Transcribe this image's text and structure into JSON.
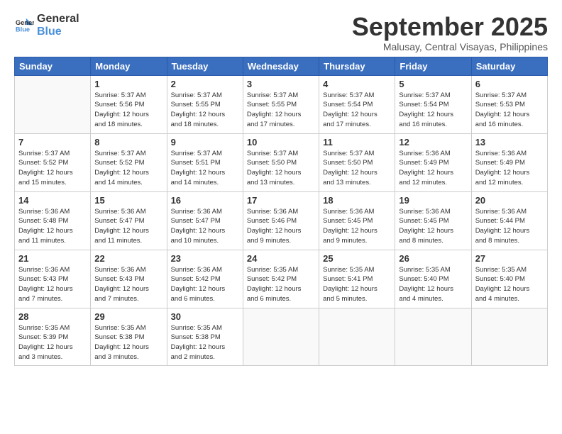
{
  "logo": {
    "text_general": "General",
    "text_blue": "Blue"
  },
  "header": {
    "month_year": "September 2025",
    "location": "Malusay, Central Visayas, Philippines"
  },
  "weekdays": [
    "Sunday",
    "Monday",
    "Tuesday",
    "Wednesday",
    "Thursday",
    "Friday",
    "Saturday"
  ],
  "weeks": [
    [
      {
        "day": "",
        "info": ""
      },
      {
        "day": "1",
        "info": "Sunrise: 5:37 AM\nSunset: 5:56 PM\nDaylight: 12 hours\nand 18 minutes."
      },
      {
        "day": "2",
        "info": "Sunrise: 5:37 AM\nSunset: 5:55 PM\nDaylight: 12 hours\nand 18 minutes."
      },
      {
        "day": "3",
        "info": "Sunrise: 5:37 AM\nSunset: 5:55 PM\nDaylight: 12 hours\nand 17 minutes."
      },
      {
        "day": "4",
        "info": "Sunrise: 5:37 AM\nSunset: 5:54 PM\nDaylight: 12 hours\nand 17 minutes."
      },
      {
        "day": "5",
        "info": "Sunrise: 5:37 AM\nSunset: 5:54 PM\nDaylight: 12 hours\nand 16 minutes."
      },
      {
        "day": "6",
        "info": "Sunrise: 5:37 AM\nSunset: 5:53 PM\nDaylight: 12 hours\nand 16 minutes."
      }
    ],
    [
      {
        "day": "7",
        "info": "Sunrise: 5:37 AM\nSunset: 5:52 PM\nDaylight: 12 hours\nand 15 minutes."
      },
      {
        "day": "8",
        "info": "Sunrise: 5:37 AM\nSunset: 5:52 PM\nDaylight: 12 hours\nand 14 minutes."
      },
      {
        "day": "9",
        "info": "Sunrise: 5:37 AM\nSunset: 5:51 PM\nDaylight: 12 hours\nand 14 minutes."
      },
      {
        "day": "10",
        "info": "Sunrise: 5:37 AM\nSunset: 5:50 PM\nDaylight: 12 hours\nand 13 minutes."
      },
      {
        "day": "11",
        "info": "Sunrise: 5:37 AM\nSunset: 5:50 PM\nDaylight: 12 hours\nand 13 minutes."
      },
      {
        "day": "12",
        "info": "Sunrise: 5:36 AM\nSunset: 5:49 PM\nDaylight: 12 hours\nand 12 minutes."
      },
      {
        "day": "13",
        "info": "Sunrise: 5:36 AM\nSunset: 5:49 PM\nDaylight: 12 hours\nand 12 minutes."
      }
    ],
    [
      {
        "day": "14",
        "info": "Sunrise: 5:36 AM\nSunset: 5:48 PM\nDaylight: 12 hours\nand 11 minutes."
      },
      {
        "day": "15",
        "info": "Sunrise: 5:36 AM\nSunset: 5:47 PM\nDaylight: 12 hours\nand 11 minutes."
      },
      {
        "day": "16",
        "info": "Sunrise: 5:36 AM\nSunset: 5:47 PM\nDaylight: 12 hours\nand 10 minutes."
      },
      {
        "day": "17",
        "info": "Sunrise: 5:36 AM\nSunset: 5:46 PM\nDaylight: 12 hours\nand 9 minutes."
      },
      {
        "day": "18",
        "info": "Sunrise: 5:36 AM\nSunset: 5:45 PM\nDaylight: 12 hours\nand 9 minutes."
      },
      {
        "day": "19",
        "info": "Sunrise: 5:36 AM\nSunset: 5:45 PM\nDaylight: 12 hours\nand 8 minutes."
      },
      {
        "day": "20",
        "info": "Sunrise: 5:36 AM\nSunset: 5:44 PM\nDaylight: 12 hours\nand 8 minutes."
      }
    ],
    [
      {
        "day": "21",
        "info": "Sunrise: 5:36 AM\nSunset: 5:43 PM\nDaylight: 12 hours\nand 7 minutes."
      },
      {
        "day": "22",
        "info": "Sunrise: 5:36 AM\nSunset: 5:43 PM\nDaylight: 12 hours\nand 7 minutes."
      },
      {
        "day": "23",
        "info": "Sunrise: 5:36 AM\nSunset: 5:42 PM\nDaylight: 12 hours\nand 6 minutes."
      },
      {
        "day": "24",
        "info": "Sunrise: 5:35 AM\nSunset: 5:42 PM\nDaylight: 12 hours\nand 6 minutes."
      },
      {
        "day": "25",
        "info": "Sunrise: 5:35 AM\nSunset: 5:41 PM\nDaylight: 12 hours\nand 5 minutes."
      },
      {
        "day": "26",
        "info": "Sunrise: 5:35 AM\nSunset: 5:40 PM\nDaylight: 12 hours\nand 4 minutes."
      },
      {
        "day": "27",
        "info": "Sunrise: 5:35 AM\nSunset: 5:40 PM\nDaylight: 12 hours\nand 4 minutes."
      }
    ],
    [
      {
        "day": "28",
        "info": "Sunrise: 5:35 AM\nSunset: 5:39 PM\nDaylight: 12 hours\nand 3 minutes."
      },
      {
        "day": "29",
        "info": "Sunrise: 5:35 AM\nSunset: 5:38 PM\nDaylight: 12 hours\nand 3 minutes."
      },
      {
        "day": "30",
        "info": "Sunrise: 5:35 AM\nSunset: 5:38 PM\nDaylight: 12 hours\nand 2 minutes."
      },
      {
        "day": "",
        "info": ""
      },
      {
        "day": "",
        "info": ""
      },
      {
        "day": "",
        "info": ""
      },
      {
        "day": "",
        "info": ""
      }
    ]
  ]
}
